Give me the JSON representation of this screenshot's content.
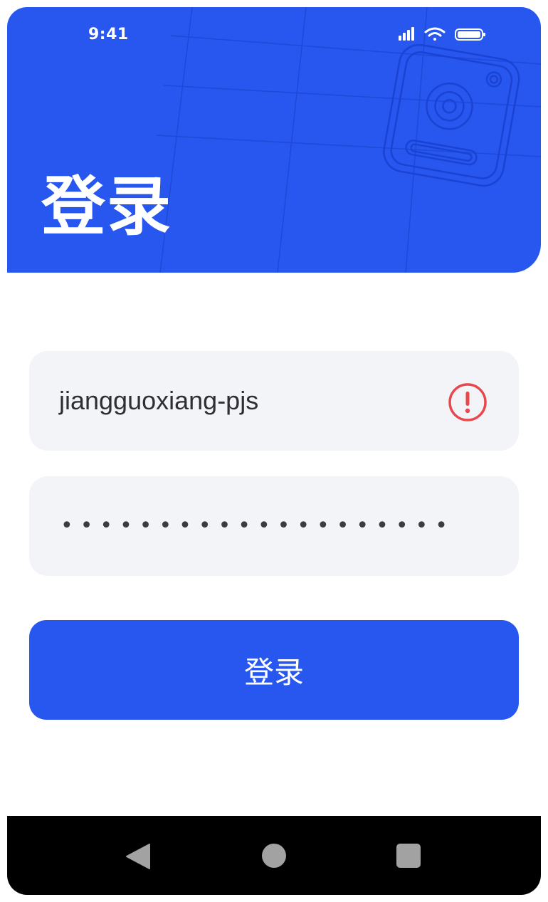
{
  "status_bar": {
    "time": "9:41",
    "icons": [
      "signal-icon",
      "wifi-icon",
      "battery-icon"
    ]
  },
  "header": {
    "title": "登录",
    "decoration_icon": "camera-device-icon"
  },
  "form": {
    "username": {
      "value": "jiangguoxiang-pjs",
      "status_icon": "error-alert-icon"
    },
    "password": {
      "masked_value": "••••••••••••••••••••"
    },
    "submit_label": "登录"
  },
  "nav_bar": {
    "buttons": [
      "back-icon",
      "home-icon",
      "recent-apps-icon"
    ]
  },
  "colors": {
    "primary": "#2757ef",
    "field_background": "#f3f4f8",
    "error": "#e8474c",
    "nav_background": "#000000"
  }
}
